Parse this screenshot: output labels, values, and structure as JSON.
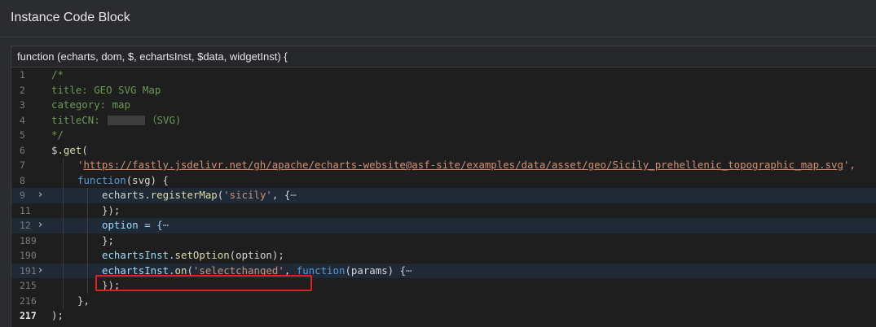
{
  "panel": {
    "title": "Instance Code Block"
  },
  "editor": {
    "signature": "function (echarts, dom, $, echartsInst, $data, widgetInst) {",
    "lines": [
      {
        "num": "1"
      },
      {
        "num": "2"
      },
      {
        "num": "3"
      },
      {
        "num": "4"
      },
      {
        "num": "5"
      },
      {
        "num": "6"
      },
      {
        "num": "7"
      },
      {
        "num": "8"
      },
      {
        "num": "9"
      },
      {
        "num": "11"
      },
      {
        "num": "12"
      },
      {
        "num": "189"
      },
      {
        "num": "190"
      },
      {
        "num": "191"
      },
      {
        "num": "215"
      },
      {
        "num": "216"
      },
      {
        "num": "217"
      }
    ],
    "text": {
      "l1": "/*",
      "l2": "title: GEO SVG Map",
      "l3": "category: map",
      "l4a": "titleCN: ",
      "l4b": "（SVG)",
      "l5": "*/",
      "l6a": "$.",
      "l6b": "get",
      "l6c": "(",
      "l7q1": "'",
      "l7url": "https://fastly.jsdelivr.net/gh/apache/echarts-website@asf-site/examples/data/asset/geo/Sicily_prehellenic_topographic_map.svg",
      "l7q2": "',",
      "l8a": "function",
      "l8b": "(svg) {",
      "l9a": "echarts.",
      "l9b": "registerMap",
      "l9c": "(",
      "l9d": "'sicily'",
      "l9e": ", {",
      "l9f": "⋯",
      "l11": "});",
      "l12a": "option = {",
      "l12b": "⋯",
      "l189": "};",
      "l190a": "echartsInst.",
      "l190b": "setOption",
      "l190c": "(option);",
      "l191a": "echartsInst.",
      "l191b": "on",
      "l191c": "(",
      "l191d": "'selectchanged'",
      "l191e": ", ",
      "l191f": "function",
      "l191g": "(params) {",
      "l191h": "⋯",
      "l215": "});",
      "l216": "},",
      "l217": ");"
    }
  },
  "icons": {
    "fold": "chevron-right-icon"
  },
  "colors": {
    "highlight": "#e02020",
    "comment": "#6a9955",
    "string": "#ce9178",
    "keyword": "#569cd6"
  }
}
